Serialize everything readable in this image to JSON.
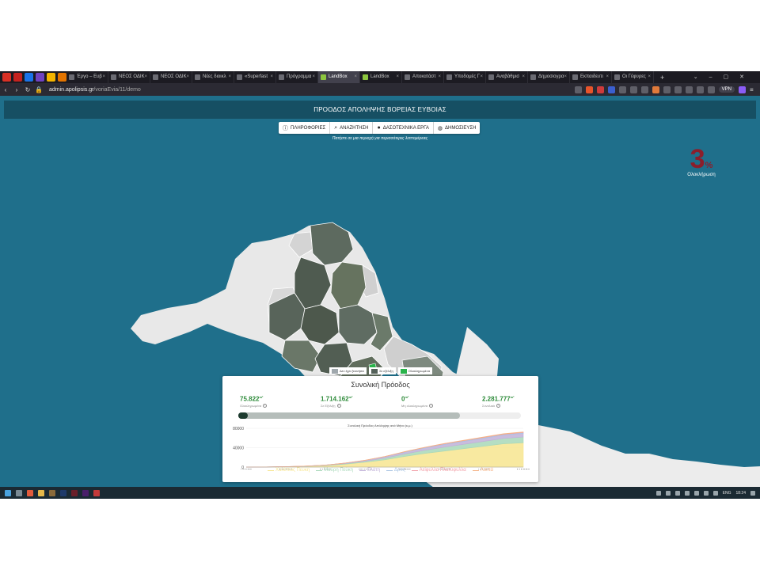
{
  "browser": {
    "tabs": [
      {
        "label": "",
        "color": "#d93025"
      },
      {
        "label": "",
        "color": "#c5221f"
      },
      {
        "label": "",
        "color": "#1a73e8"
      },
      {
        "label": "",
        "color": "#6f42c1"
      },
      {
        "label": "",
        "color": "#f4b400"
      },
      {
        "label": "",
        "color": "#e37400"
      },
      {
        "label": "Έργο – Ευβ"
      },
      {
        "label": "ΝΕΟΣ ΟΔΙΚ"
      },
      {
        "label": "ΝΕΟΣ ΟΔΙΚ"
      },
      {
        "label": "Νέες διοικλ"
      },
      {
        "label": "«Superfast"
      },
      {
        "label": "Πρόγραμμα"
      },
      {
        "label": "LandBox",
        "active": true,
        "green": true
      },
      {
        "label": "LandBox",
        "green": true
      },
      {
        "label": "Αποκατάστ"
      },
      {
        "label": "Υποδομές Γ"
      },
      {
        "label": "Αναβάθμισ"
      },
      {
        "label": "Δημοσιογρα"
      },
      {
        "label": "Εκπαιδευτι"
      },
      {
        "label": "Οι Γέφυρες"
      }
    ],
    "new_tab": "+",
    "url_host": "admin.apolipsis.gr",
    "url_path": "/voriaEvia/11/demo",
    "vpn_label": "VPN"
  },
  "header": {
    "title": "ΠΡΟΟΔΟΣ ΑΠΟΛΗΨΗΣ ΒΟΡΕΙΑΣ ΕΥΒΟΙΑΣ"
  },
  "toolbar": {
    "info": "ΠΛΗΡΟΦΟΡΙΕΣ",
    "search": "ΑΝΑΖΗΤΗΣΗ",
    "forest_works": "ΔΑΣΟΤΕΧΝΙΚΑ ΕΡΓΑ",
    "publication": "ΔΗΜΟΣΙΕΥΣΗ"
  },
  "hint": "Πατήστε σε μια περιοχή για περισσότερες λεπτομέρειες",
  "completion": {
    "value": "3",
    "unit": "%",
    "label": "Ολοκλήρωση"
  },
  "legend": [
    {
      "label": "Δεν έχει ξεκινήσει",
      "color": "#a0a8ad"
    },
    {
      "label": "Σε εξέλιξη",
      "color": "#55625a"
    },
    {
      "label": "Ολοκληρωμένα",
      "color": "#29b34a"
    }
  ],
  "colors": {
    "sea": "#1f6f8b",
    "land": "#ececec",
    "not_started": "#d4d4d4",
    "in_progress": "#5a665c",
    "in_progress_dark": "#45503f",
    "completed": "#29b34a",
    "accent_green": "#2e8b3a"
  },
  "progress": {
    "title": "Συνολική Πρόοδος",
    "completed_value": "75.822",
    "completed_label": "Ολοκληρωμένα",
    "in_progress_value": "1.714.162",
    "in_progress_label": "Σε Εξέλιξη",
    "not_started_value": "0",
    "not_started_label": "Μη ολοκληρωμένα",
    "total_value": "2.281.777",
    "total_label": "Συνολικά",
    "unit": "m²",
    "bar_completed_fraction": 0.033,
    "bar_in_progress_fraction": 0.785
  },
  "chart_data": {
    "type": "area",
    "title": "Συνολική Πρόοδος Απόληψης ανά Μήνα (κ.μ.)",
    "categories": [
      "ΙΑΝ22",
      "ΦΕΒ22",
      "ΜΑΡ22",
      "ΑΠΡ22",
      "ΜΑΙ22",
      "ΙΟΥΝ22",
      "ΙΟΥΛ22",
      "ΑΥΓ22",
      "ΣΕΠ22",
      "ΟΚΤ22",
      "ΝΟΕ22",
      "ΔΕΚ22",
      "ΙΑΝ23",
      "ΦΕΒ23",
      "ΜΑΡ23"
    ],
    "tick_labels": [
      "ΙΑΝ22",
      "ΜΑΡ22",
      "ΜΑΙ22",
      "ΙΟΥΛ22",
      "ΣΕΠ22",
      "ΝΟΕ22",
      "ΙΑΝ23",
      "ΜΑΡ23"
    ],
    "yticks": [
      "0",
      "40000",
      "80000"
    ],
    "ylim": [
      0,
      80000
    ],
    "series": [
      {
        "name": "Χαλέπιος Πεύκη",
        "color": "#f7e58f",
        "values": [
          0,
          200,
          600,
          1500,
          3000,
          6000,
          10000,
          15000,
          22000,
          28000,
          33000,
          38000,
          43000,
          48000,
          50000
        ]
      },
      {
        "name": "Μαύρη Πεύκη",
        "color": "#a8d8b9",
        "values": [
          0,
          50,
          150,
          300,
          600,
          1200,
          2000,
          3500,
          5000,
          6500,
          8000,
          9000,
          10000,
          11000,
          12000
        ]
      },
      {
        "name": "Ελάτη",
        "color": "#c0b0d8",
        "values": [
          0,
          30,
          80,
          200,
          400,
          800,
          1500,
          2500,
          3500,
          4500,
          5500,
          6000,
          6500,
          7000,
          7500
        ]
      },
      {
        "name": "Δρυς",
        "color": "#a9c4e3",
        "values": [
          0,
          10,
          30,
          60,
          120,
          250,
          400,
          600,
          800,
          1000,
          1200,
          1300,
          1400,
          1500,
          1600
        ]
      },
      {
        "name": "Αείφυλλα Πλατύφυλλα",
        "color": "#f2a0a8",
        "values": [
          0,
          5,
          10,
          20,
          40,
          80,
          120,
          200,
          300,
          400,
          500,
          550,
          600,
          650,
          700
        ]
      },
      {
        "name": "Λοιπά",
        "color": "#f4b183",
        "values": [
          0,
          5,
          10,
          20,
          40,
          80,
          120,
          200,
          300,
          400,
          500,
          550,
          600,
          650,
          700
        ]
      }
    ]
  },
  "system": {
    "lang": "ENG",
    "time": "18:24"
  }
}
